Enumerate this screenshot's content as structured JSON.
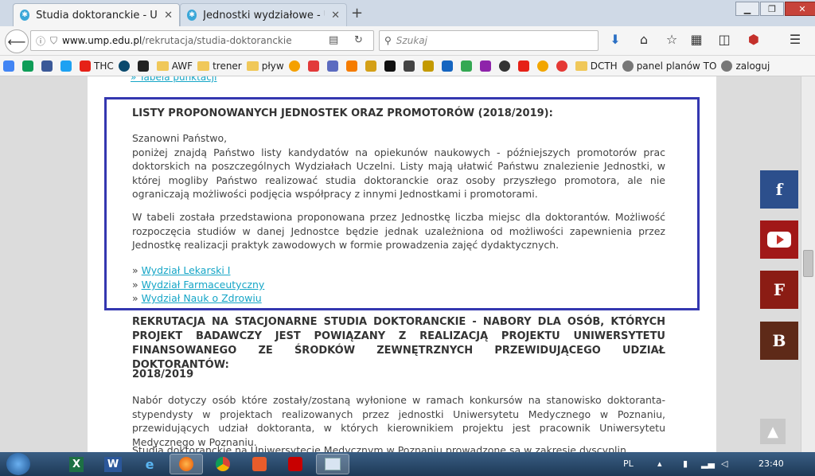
{
  "tabs": [
    {
      "title": "Studia doktoranckie - Uniw...",
      "active": true
    },
    {
      "title": "Jednostki wydziałowe - Uni...",
      "active": false
    }
  ],
  "window_controls": {
    "minimize": "▁",
    "restore": "❐",
    "close": "✕"
  },
  "navbar": {
    "url_domain": "www.ump.edu.pl",
    "url_path": "/rekrutacja/studia-doktoranckie",
    "search_placeholder": "Szukaj"
  },
  "bookmarks": [
    {
      "label": "THC",
      "type": "site"
    },
    {
      "label": "AWF",
      "type": "folder"
    },
    {
      "label": "trener",
      "type": "folder"
    },
    {
      "label": "pływ",
      "type": "folder"
    },
    {
      "label": "DCTH",
      "type": "folder"
    },
    {
      "label": "panel planów TO",
      "type": "site"
    },
    {
      "label": "zaloguj",
      "type": "site"
    }
  ],
  "page": {
    "cropped_link": "» Tabela punktacji",
    "box_heading": "LISTY PROPONOWANYCH JEDNOSTEK ORAZ PROMOTORÓW (2018/2019):",
    "box_para1": "Szanowni Państwo,\nponiżej znajdą Państwo listy kandydatów na opiekunów naukowych - późniejszych promotorów prac doktorskich na poszczególnych Wydziałach Uczelni. Listy mają ułatwić Państwu znalezienie Jednostki, w której mogliby Państwo realizować studia doktoranckie oraz osoby przyszłego promotora, ale nie ograniczają możliwości podjęcia współpracy z innymi Jednostkami i promotorami.",
    "box_para2": "W tabeli została przedstawiona proponowana przez Jednostkę liczba miejsc dla doktorantów. Możliwość rozpoczęcia studiów w danej Jednostce będzie jednak uzależniona od możliwości zapewnienia przez Jednostkę realizacji praktyk zawodowych w formie prowadzenia zajęć dydaktycznych.",
    "faculty_links": [
      "Wydział Lekarski I",
      "Wydział Farmaceutyczny",
      "Wydział Nauk o Zdrowiu"
    ],
    "link_prefix": "»",
    "section_heading": "REKRUTACJA NA STACJONARNE STUDIA DOKTORANCKIE - NABORY DLA OSÓB, KTÓRYCH PROJEKT BADAWCZY JEST POWIĄZANY Z REALIZACJĄ PROJEKTU UNIWERSYTETU FINANSOWANEGO ZE ŚRODKÓW ZEWNĘTRZNYCH PRZEWIDUJĄCEGO UDZIAŁ DOKTORANTÓW:",
    "year_heading": "2018/2019",
    "section_para": "Nabór dotyczy osób które zostały/zostaną wyłonione w ramach konkursów na stanowisko doktoranta-stypendysty w projektach realizowanych przez jednostki Uniwersytetu Medycznego w Poznaniu, przewidujących udział doktoranta, w których kierownikiem projektu jest pracownik Uniwersytetu Medycznego w Poznaniu.",
    "cut_para": "Studia doktoranckie na Uniwersytecie Medycznym w Poznaniu prowadzone są w zakresie dyscyplin"
  },
  "social": {
    "facebook": "f",
    "f2": "F",
    "b2": "B"
  },
  "taskbar": {
    "language": "PL",
    "time": "23:40"
  },
  "colors": {
    "box_border": "#3437b0",
    "link": "#16a6c7",
    "heading": "#333333"
  }
}
